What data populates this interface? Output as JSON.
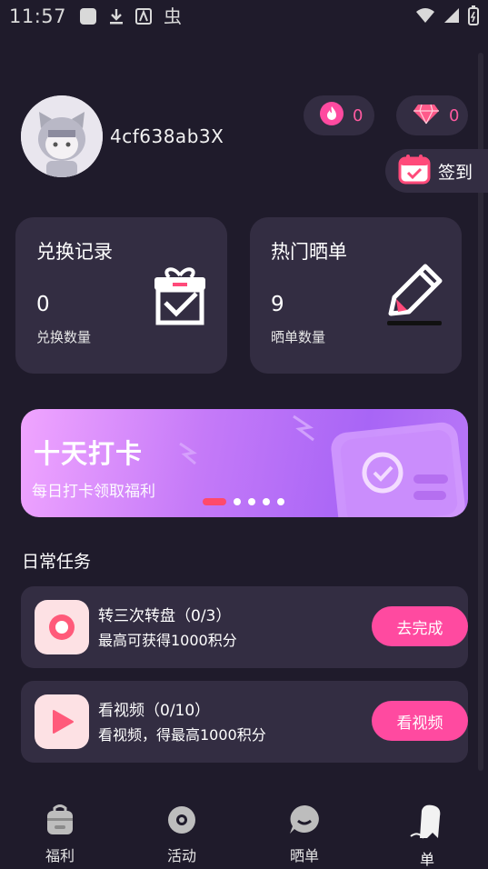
{
  "status_bar": {
    "time": "11:57",
    "icons": [
      "notification-square-icon",
      "download-icon",
      "app-a-icon",
      "bug-icon",
      "wifi-icon",
      "signal-icon",
      "battery-icon"
    ]
  },
  "profile": {
    "username": "4cf638ab3X"
  },
  "badges": {
    "fire_count": "0",
    "gem_count": "0"
  },
  "checkin": {
    "label": "签到"
  },
  "cards": [
    {
      "title": "兑换记录",
      "value": "0",
      "subtitle": "兑换数量",
      "icon": "gift-box-icon"
    },
    {
      "title": "热门晒单",
      "value": "9",
      "subtitle": "晒单数量",
      "icon": "pencil-icon"
    }
  ],
  "banner": {
    "title": "十天打卡",
    "subtitle": "每日打卡领取福利",
    "page_count": 5,
    "active_index": 0
  },
  "daily_tasks": {
    "section_title": "日常任务",
    "items": [
      {
        "name": "转三次转盘（0/3）",
        "desc": "最高可获得1000积分",
        "button": "去完成",
        "icon": "record-icon"
      },
      {
        "name": "看视频（0/10）",
        "desc": "看视频，得最高1000积分",
        "button": "看视频",
        "icon": "play-icon"
      }
    ]
  },
  "tabbar": {
    "items": [
      {
        "label": "福利",
        "icon": "bag-icon"
      },
      {
        "label": "活动",
        "icon": "disc-icon"
      },
      {
        "label": "晒单",
        "icon": "chat-bubble-icon"
      },
      {
        "label": "单",
        "icon": "ghost-icon"
      }
    ]
  },
  "colors": {
    "background": "#1f1b2b",
    "card": "#332d42",
    "accent_pink": "#ff4aa0",
    "banner_start": "#f0a5ff",
    "banner_end": "#a865f6"
  }
}
